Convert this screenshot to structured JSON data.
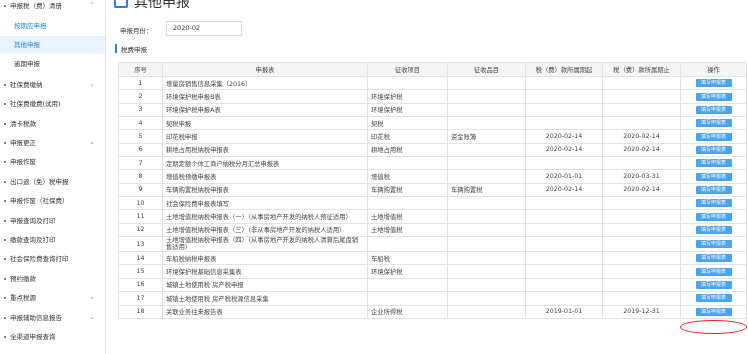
{
  "sidebar": {
    "items": [
      {
        "label": "申报税（费）清册",
        "chevron": "⌃"
      },
      {
        "label": "按期应申报",
        "sub": true
      },
      {
        "label": "其他申报",
        "sub": true
      },
      {
        "label": "逾期申报",
        "sub": true
      },
      {
        "label": "社保费缴纳",
        "chevron": "⌄"
      },
      {
        "label": "社保费缴费(试用)"
      },
      {
        "label": "清卡税款"
      },
      {
        "label": "申报更正",
        "chevron": "⌄"
      },
      {
        "label": "申报作废"
      },
      {
        "label": "出口退（免）税申报"
      },
      {
        "label": "申报作废（社保费）"
      },
      {
        "label": "申报查询及打印"
      },
      {
        "label": "缴款查询及打印"
      },
      {
        "label": "社会保险费查询打印"
      },
      {
        "label": "预约缴款"
      },
      {
        "label": "重点税源",
        "chevron": "⌄"
      },
      {
        "label": "申报辅助信息报告",
        "chevron": "⌄"
      },
      {
        "label": "全渠道申报查询"
      }
    ]
  },
  "page": {
    "title": "其他申报",
    "month_label": "申报月份：",
    "month_value": "2020-02",
    "section_title": "税费申报"
  },
  "table": {
    "headers": [
      "序号",
      "申报表",
      "征收项目",
      "征收品目",
      "税（费）款所属期起",
      "税（费）款所属期止",
      "操作"
    ],
    "button_label": "填写申报表",
    "rows": [
      {
        "no": "1",
        "form": "增量房销售信息采集（2016）",
        "item": "",
        "sub": "",
        "start": "",
        "end": ""
      },
      {
        "no": "2",
        "form": "环境保护税申报B表",
        "item": "环境保护税",
        "sub": "",
        "start": "",
        "end": ""
      },
      {
        "no": "3",
        "form": "环境保护税申报A表",
        "item": "环境保护税",
        "sub": "",
        "start": "",
        "end": ""
      },
      {
        "no": "4",
        "form": "契税申报",
        "item": "契税",
        "sub": "",
        "start": "",
        "end": ""
      },
      {
        "no": "5",
        "form": "印花税申报",
        "item": "印花税",
        "sub": "资金账簿",
        "start": "2020-02-14",
        "end": "2020-02-14"
      },
      {
        "no": "6",
        "form": "耕地占用税纳税申报表",
        "item": "耕地占用税",
        "sub": "",
        "start": "2020-02-14",
        "end": "2020-02-14"
      },
      {
        "no": "7",
        "form": "定期定额个体工商户纳税分月汇总申报表",
        "item": "",
        "sub": "",
        "start": "",
        "end": ""
      },
      {
        "no": "8",
        "form": "增值税预缴申报表",
        "item": "增值税",
        "sub": "",
        "start": "2020-01-01",
        "end": "2020-03-31"
      },
      {
        "no": "9",
        "form": "车辆购置税纳税申报表",
        "item": "车辆购置税",
        "sub": "车辆购置税",
        "start": "2020-02-14",
        "end": "2020-02-14"
      },
      {
        "no": "10",
        "form": "社会保险费申报表填写",
        "item": "",
        "sub": "",
        "start": "",
        "end": ""
      },
      {
        "no": "11",
        "form": "土地增值税纳税申报表（一）（从事房地产开发的纳税人预征适用）",
        "item": "土地增值税",
        "sub": "",
        "start": "",
        "end": ""
      },
      {
        "no": "12",
        "form": "土地增值税纳税申报表（三）（非从事房地产开发的纳税人适用）",
        "item": "土地增值税",
        "sub": "",
        "start": "",
        "end": ""
      },
      {
        "no": "13",
        "form": "土地增值税纳税申报表（四）（从事房地产开发的纳税人清算后尾盘销售适用）",
        "item": "",
        "sub": "",
        "start": "",
        "end": "",
        "wrap": true
      },
      {
        "no": "14",
        "form": "车船税纳税申报表",
        "item": "车船税",
        "sub": "",
        "start": "",
        "end": ""
      },
      {
        "no": "15",
        "form": "环境保护税基础信息采集表",
        "item": "环境保护税",
        "sub": "",
        "start": "",
        "end": ""
      },
      {
        "no": "16",
        "form": "城镇土地使用税 房产税申报",
        "item": "",
        "sub": "",
        "start": "",
        "end": ""
      },
      {
        "no": "17",
        "form": "城镇土地使用税 房产税税源信息采集",
        "item": "",
        "sub": "",
        "start": "",
        "end": ""
      },
      {
        "no": "18",
        "form": "关联业务往来报告表",
        "item": "企业所得税",
        "sub": "",
        "start": "2019-01-01",
        "end": "2019-12-31"
      }
    ]
  },
  "colors": {
    "accent": "#1e88e5",
    "button": "#4aa3ee",
    "highlight": "#e22222"
  }
}
